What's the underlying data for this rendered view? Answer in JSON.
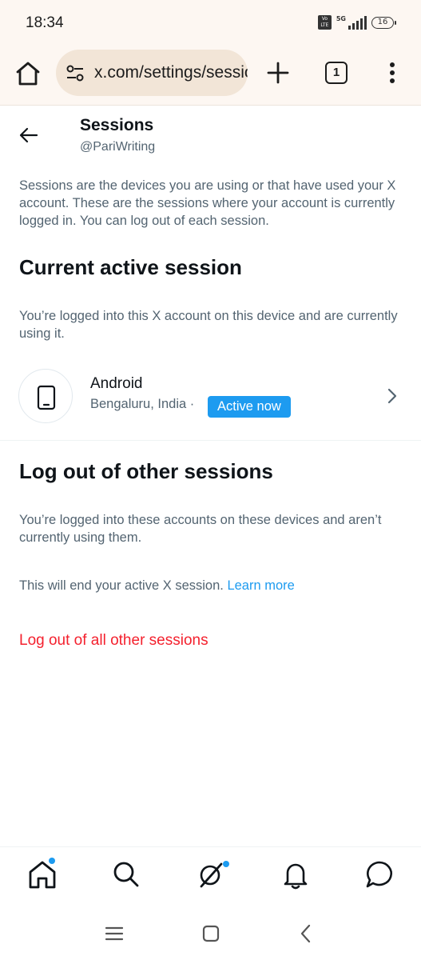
{
  "status_bar": {
    "time": "18:34",
    "network": "5G",
    "volte": "Vo LTE",
    "battery": "16"
  },
  "browser": {
    "url": "x.com/settings/sessions",
    "tab_count": "1",
    "icons": [
      "home-icon",
      "tune-icon",
      "plus-icon",
      "tabs-icon",
      "more-vert-icon"
    ]
  },
  "header": {
    "title": "Sessions",
    "handle": "@PariWriting"
  },
  "intro": "Sessions are the devices you are using or that have used your X account. These are the sessions where your account is currently logged in. You can log out of each session.",
  "current_session": {
    "heading": "Current active session",
    "description": "You’re logged into this X account on this device and are currently using it.",
    "device": "Android",
    "location": "Bengaluru, India ·",
    "badge": "Active now"
  },
  "other_sessions": {
    "heading": "Log out of other sessions",
    "description": "You’re logged into these accounts on these devices and aren’t currently using them.",
    "note": "This will end your active X session.",
    "learn_more": "Learn more",
    "logout_all": "Log out of all other sessions"
  },
  "bottom_nav": [
    "home-icon",
    "search-icon",
    "grok-icon",
    "notifications-icon",
    "messages-icon"
  ],
  "colors": {
    "accent": "#1d9bf0",
    "danger": "#f4212e",
    "secondary_text": "#536471",
    "browser_bar": "#fdf7f2"
  }
}
